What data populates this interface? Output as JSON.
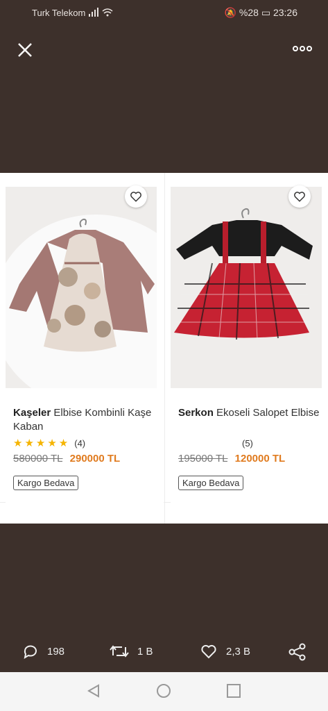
{
  "status": {
    "carrier": "Turk Telekom",
    "battery": "%28",
    "time": "23:26"
  },
  "products": [
    {
      "brand": "Kaşeler",
      "name": "Elbise Kombinli Kaşe Kaban",
      "rating_count": "(4)",
      "old_price": "580000 TL",
      "new_price": "290000 TL",
      "badge": "Kargo Bedava",
      "stars": "★★★★★"
    },
    {
      "brand": "Serkon",
      "name": "Ekoseli Salopet Elbise",
      "rating_count": "(5)",
      "old_price": "195000 TL",
      "new_price": "120000 TL",
      "badge": "Kargo Bedava"
    }
  ],
  "actions": {
    "comments": "198",
    "retweets": "1 B",
    "likes": "2,3 B"
  },
  "colors": {
    "background": "#3d302b",
    "price": "#e07b1f",
    "star": "#f5b400"
  }
}
